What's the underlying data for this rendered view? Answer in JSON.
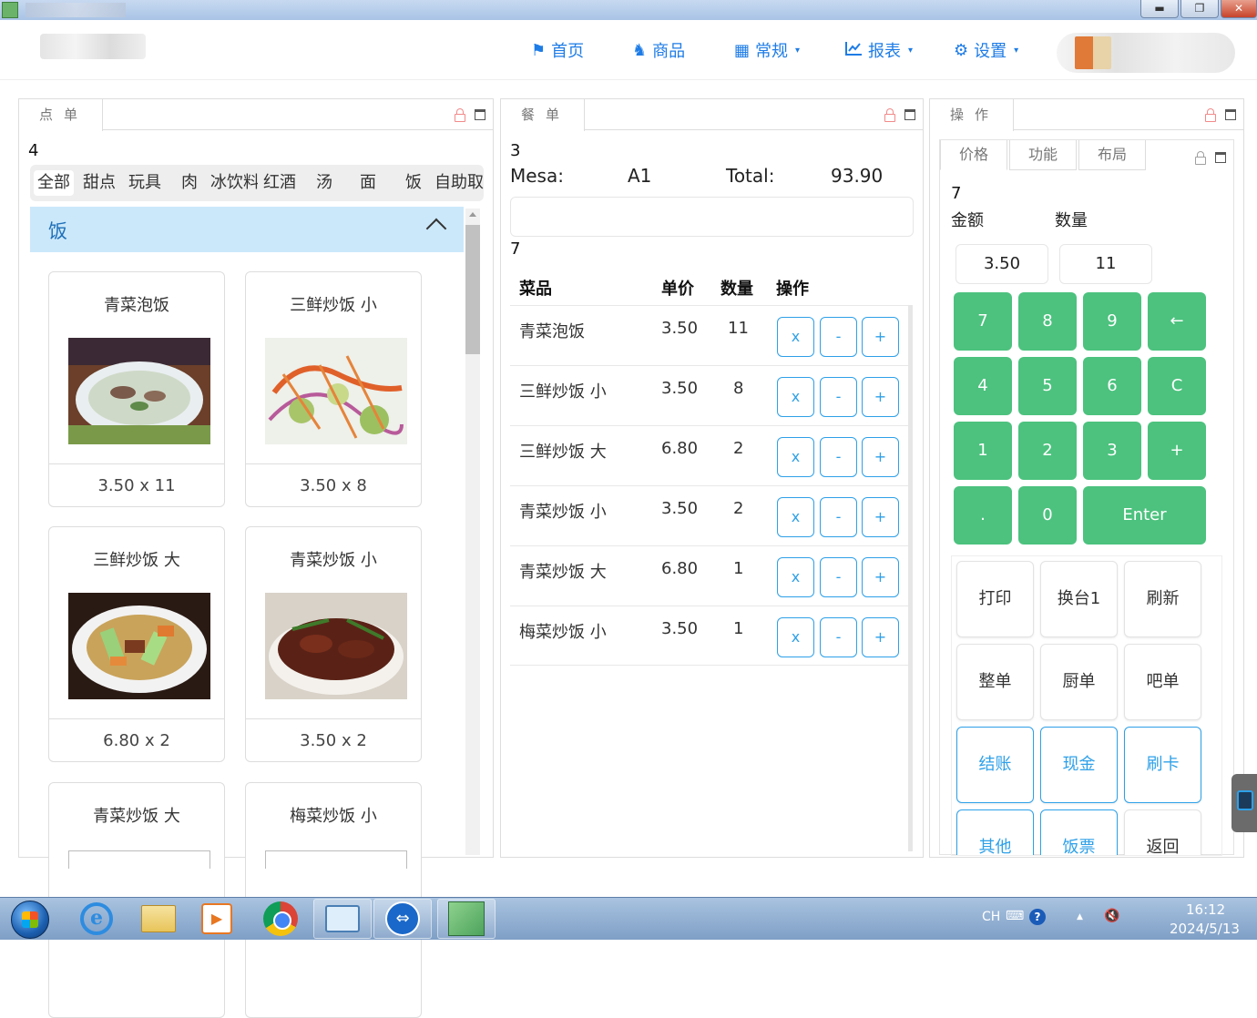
{
  "window": {
    "min_glyph": "▬",
    "restore_glyph": "❐",
    "close_glyph": "✕"
  },
  "nav": {
    "items": [
      {
        "label": "首页",
        "icon": "flag-icon",
        "glyph": "⚑",
        "dropdown": false
      },
      {
        "label": "商品",
        "icon": "horse-icon",
        "glyph": "♞",
        "dropdown": false
      },
      {
        "label": "常规",
        "icon": "table-icon",
        "glyph": "▦",
        "dropdown": true
      },
      {
        "label": "报表",
        "icon": "chart-icon",
        "glyph": "📈",
        "dropdown": true
      },
      {
        "label": "设置",
        "icon": "gear-icon",
        "glyph": "⚙",
        "dropdown": true
      }
    ],
    "caret": "▾",
    "accent_color": "#1e7ce6"
  },
  "left_panel": {
    "tab": "点单",
    "count": "4",
    "categories": [
      "全部",
      "甜点",
      "玩具",
      "肉",
      "冰饮料",
      "红酒",
      "汤",
      "面",
      "饭",
      "自助取菜"
    ],
    "active_category": "全部",
    "group_title": "饭",
    "dishes": [
      {
        "name": "青菜泡饭",
        "price_qty": "3.50 x 11",
        "image": "soup-rice-photo"
      },
      {
        "name": "三鲜炒饭 小",
        "price_qty": "3.50 x 8",
        "image": "salad-photo"
      },
      {
        "name": "三鲜炒饭 大",
        "price_qty": "6.80 x 2",
        "image": "stir-fry-photo"
      },
      {
        "name": "青菜炒饭 小",
        "price_qty": "3.50 x 2",
        "image": "braised-meat-photo"
      },
      {
        "name": "青菜炒饭 大",
        "price_qty": "",
        "image": "broken-image"
      },
      {
        "name": "梅菜炒饭 小",
        "price_qty": "",
        "image": "broken-image"
      }
    ]
  },
  "mid_panel": {
    "tab": "餐单",
    "count": "3",
    "mesa_label": "Mesa:",
    "mesa_value": "A1",
    "total_label": "Total:",
    "total_value": "93.90",
    "count2": "7",
    "headers": {
      "dish": "菜品",
      "price": "单价",
      "qty": "数量",
      "ops": "操作"
    },
    "rows": [
      {
        "dish": "青菜泡饭",
        "price": "3.50",
        "qty": "11"
      },
      {
        "dish": "三鲜炒饭 小",
        "price": "3.50",
        "qty": "8"
      },
      {
        "dish": "三鲜炒饭 大",
        "price": "6.80",
        "qty": "2"
      },
      {
        "dish": "青菜炒饭 小",
        "price": "3.50",
        "qty": "2"
      },
      {
        "dish": "青菜炒饭 大",
        "price": "6.80",
        "qty": "1"
      },
      {
        "dish": "梅菜炒饭 小",
        "price": "3.50",
        "qty": "1"
      }
    ],
    "op_labels": {
      "remove": "x",
      "minus": "-",
      "plus": "+"
    },
    "op_color": "#2ea0e8"
  },
  "right_panel": {
    "tab": "操作",
    "inner_tabs": [
      "价格",
      "功能",
      "布局"
    ],
    "count": "7",
    "amount_label": "金额",
    "qty_label": "数量",
    "amount_value": "3.50",
    "qty_value": "11",
    "keypad": [
      "7",
      "8",
      "9",
      "←",
      "4",
      "5",
      "6",
      "C",
      "1",
      "2",
      "3",
      "+",
      ".",
      "0",
      "Enter"
    ],
    "keypad_color": "#4cc27e",
    "functions": [
      {
        "label": "打印",
        "style": "plain"
      },
      {
        "label": "换台1",
        "style": "plain"
      },
      {
        "label": "刷新",
        "style": "plain"
      },
      {
        "label": "整单",
        "style": "plain"
      },
      {
        "label": "厨单",
        "style": "plain"
      },
      {
        "label": "吧单",
        "style": "plain"
      },
      {
        "label": "结账",
        "style": "blue"
      },
      {
        "label": "现金",
        "style": "blue"
      },
      {
        "label": "刷卡",
        "style": "blue"
      },
      {
        "label": "其他",
        "style": "blue"
      },
      {
        "label": "饭票",
        "style": "blue"
      },
      {
        "label": "返回",
        "style": "plain"
      }
    ]
  },
  "taskbar": {
    "apps": [
      "start-button",
      "ie-icon",
      "explorer-icon",
      "media-player-icon",
      "chrome-icon",
      "remote-desktop-icon",
      "teamviewer-icon",
      "pos-app-icon"
    ],
    "ie_glyph": "e",
    "media_glyph": "▶",
    "tv_glyph": "⇔",
    "lang": "CH",
    "keyboard_glyph": "⌨",
    "help_glyph": "?",
    "up_glyph": "▲",
    "volume_glyph": "🔇",
    "time": "16:12",
    "date": "2024/5/13"
  }
}
